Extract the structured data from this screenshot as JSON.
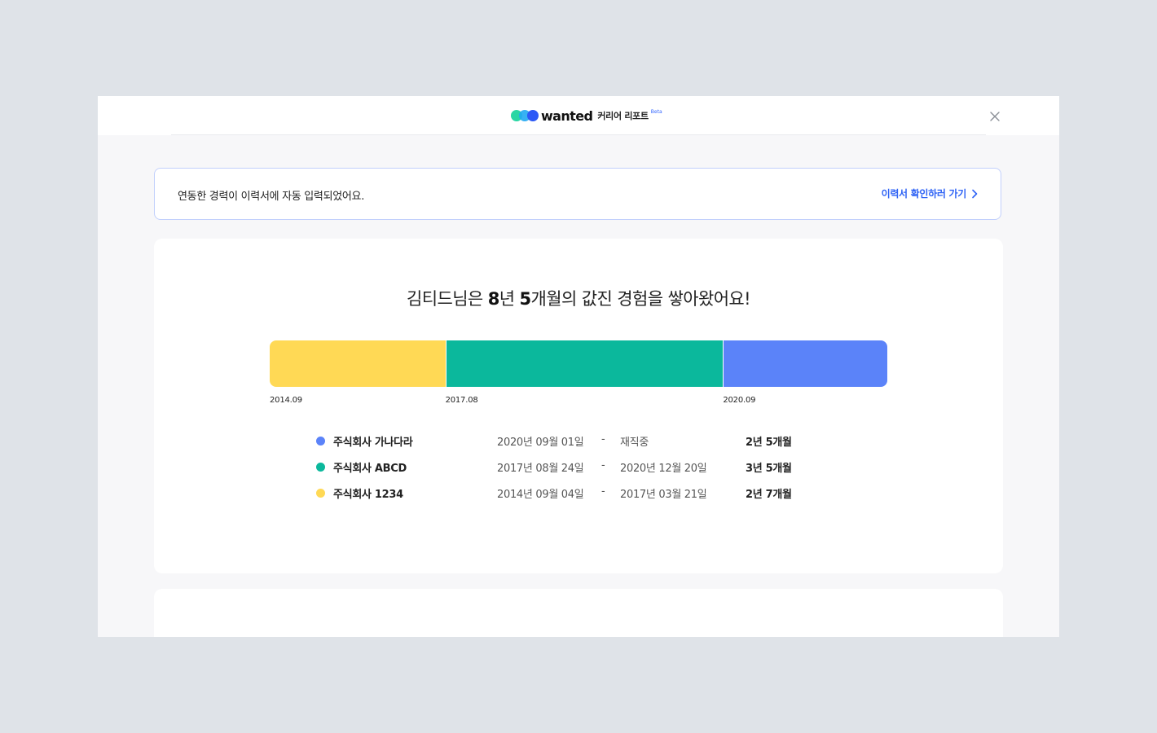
{
  "header": {
    "brand": "wanted",
    "product": "커리어 리포트",
    "beta": "Beta",
    "close_icon": "close-icon"
  },
  "notice": {
    "text": "연동한 경력이 이력서에 자동 입력되었어요.",
    "link_label": "이력서 확인하러 가기",
    "link_icon": "chevron-right-icon",
    "link_color": "#2f63f5",
    "border_color": "#c2d0fc"
  },
  "summary": {
    "name_prefix": "김티드님은 ",
    "years_number": "8",
    "years_unit": "년 ",
    "months_number": "5",
    "months_unit": "개월의 값진 경험을 쌓아왔어요!"
  },
  "timeline": {
    "segments": [
      {
        "company": "주식회사 1234",
        "months": 31,
        "color": "#ffd955"
      },
      {
        "company": "주식회사 ABCD",
        "months": 49,
        "color": "#0bb89c"
      },
      {
        "company": "주식회사 가나다라",
        "months": 29,
        "color": "#5b83f9"
      }
    ],
    "ticks": [
      "2014.09",
      "2017.08",
      "2020.09"
    ]
  },
  "careers": [
    {
      "company": "주식회사 가나다라",
      "start": "2020년 09월 01일",
      "separator": "-",
      "end": "재직중",
      "duration": "2년 5개월",
      "color": "#5b83f9"
    },
    {
      "company": "주식회사 ABCD",
      "start": "2017년 08월 24일",
      "separator": "-",
      "end": "2020년 12월 20일",
      "duration": "3년 5개월",
      "color": "#0bb89c"
    },
    {
      "company": "주식회사 1234",
      "start": "2014년 09월 04일",
      "separator": "-",
      "end": "2017년 03월 21일",
      "duration": "2년 7개월",
      "color": "#ffd955"
    }
  ]
}
